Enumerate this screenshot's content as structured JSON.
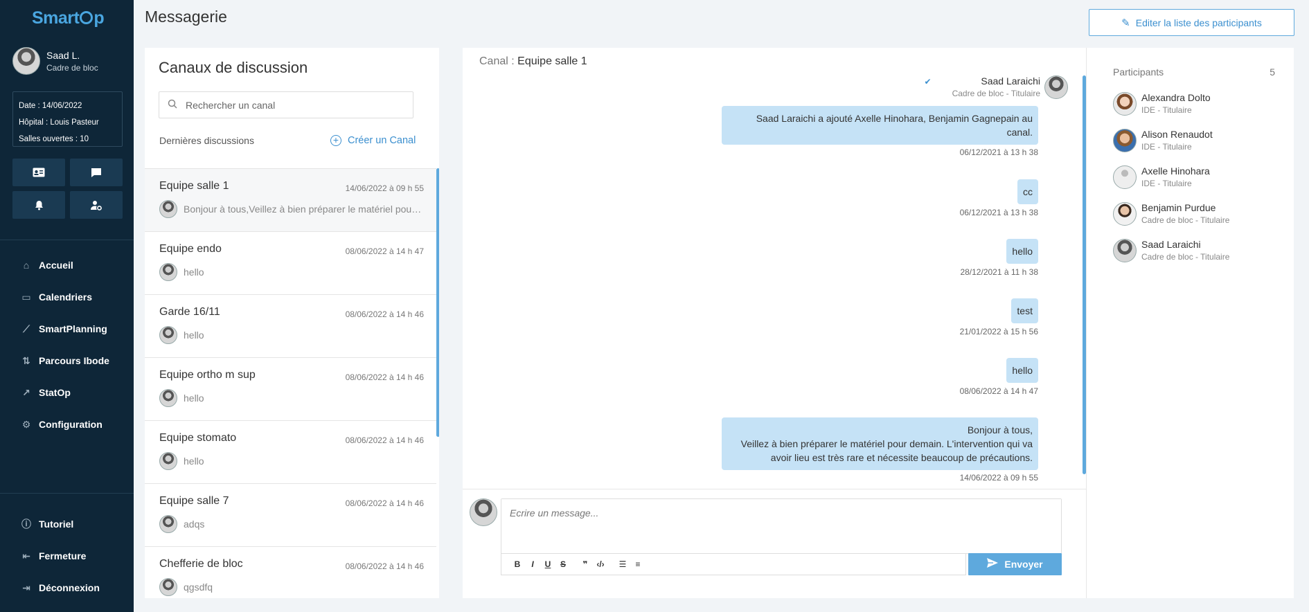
{
  "app": {
    "logo_part1": "Smart",
    "logo_part2": "p",
    "page_title": "Messagerie"
  },
  "user": {
    "name": "Saad L.",
    "role": "Cadre de bloc"
  },
  "info": {
    "date_label": "Date : ",
    "date_value": "14/06/2022",
    "hospital_label": "Hôpital : ",
    "hospital_value": "Louis Pasteur",
    "rooms_label": "Salles ouvertes : ",
    "rooms_value": "10"
  },
  "nav": [
    {
      "label": "Accueil",
      "icon": "home-icon"
    },
    {
      "label": "Calendriers",
      "icon": "calendar-icon"
    },
    {
      "label": "SmartPlanning",
      "icon": "magic-wand-icon"
    },
    {
      "label": "Parcours Ibode",
      "icon": "path-icon"
    },
    {
      "label": "StatOp",
      "icon": "chart-line-icon"
    },
    {
      "label": "Configuration",
      "icon": "gear-icon"
    }
  ],
  "nav_bottom": [
    {
      "label": "Tutoriel",
      "icon": "info-icon"
    },
    {
      "label": "Fermeture",
      "icon": "collapse-icon"
    },
    {
      "label": "Déconnexion",
      "icon": "logout-icon"
    }
  ],
  "header": {
    "edit_participants": "Editer la liste des participants"
  },
  "channels": {
    "title": "Canaux de discussion",
    "search_placeholder": "Rechercher un canal",
    "recent_label": "Dernières discussions",
    "create_label": "Créer un Canal",
    "items": [
      {
        "name": "Equipe salle 1",
        "date": "14/06/2022 à 09 h 55",
        "preview": "Bonjour à tous,Veillez à bien préparer le matériel pour demain"
      },
      {
        "name": "Equipe endo",
        "date": "08/06/2022 à 14 h 47",
        "preview": "hello"
      },
      {
        "name": "Garde 16/11",
        "date": "08/06/2022 à 14 h 46",
        "preview": "hello"
      },
      {
        "name": "Equipe ortho m sup",
        "date": "08/06/2022 à 14 h 46",
        "preview": "hello"
      },
      {
        "name": "Equipe stomato",
        "date": "08/06/2022 à 14 h 46",
        "preview": "hello"
      },
      {
        "name": "Equipe salle 7",
        "date": "08/06/2022 à 14 h 46",
        "preview": "adqs"
      },
      {
        "name": "Chefferie de bloc",
        "date": "08/06/2022 à 14 h 46",
        "preview": "qgsdfq"
      }
    ]
  },
  "chat": {
    "canal_label": "Canal : ",
    "canal_name": "Equipe salle 1",
    "sender_name": "Saad Laraichi",
    "sender_role": "Cadre de bloc - Titulaire",
    "messages": [
      {
        "text_line1": "Saad Laraichi a ajouté Axelle Hinohara, Benjamin Gagnepain au",
        "text_line2": "canal.",
        "time": "06/12/2021 à 13 h 38"
      },
      {
        "text": "cc",
        "time": "06/12/2021 à 13 h 38"
      },
      {
        "text": "hello",
        "time": "28/12/2021 à 11 h 38"
      },
      {
        "text": "test",
        "time": "21/01/2022 à 15 h 56"
      },
      {
        "text": "hello",
        "time": "08/06/2022 à 14 h 47"
      },
      {
        "text_line1": "Bonjour à tous,",
        "text_line2": "Veillez à bien préparer le matériel pour demain. L'intervention qui va",
        "text_line3": "avoir lieu est très rare et nécessite beaucoup de précautions.",
        "time": "14/06/2022 à 09 h 55"
      }
    ],
    "composer_placeholder": "Ecrire un message...",
    "send_label": "Envoyer"
  },
  "participants": {
    "title": "Participants",
    "count": "5",
    "items": [
      {
        "name": "Alexandra Dolto",
        "role": "IDE - Titulaire"
      },
      {
        "name": "Alison Renaudot",
        "role": "IDE - Titulaire"
      },
      {
        "name": "Axelle Hinohara",
        "role": "IDE - Titulaire"
      },
      {
        "name": "Benjamin Purdue",
        "role": "Cadre de bloc - Titulaire"
      },
      {
        "name": "Saad Laraichi",
        "role": "Cadre de bloc - Titulaire"
      }
    ]
  }
}
